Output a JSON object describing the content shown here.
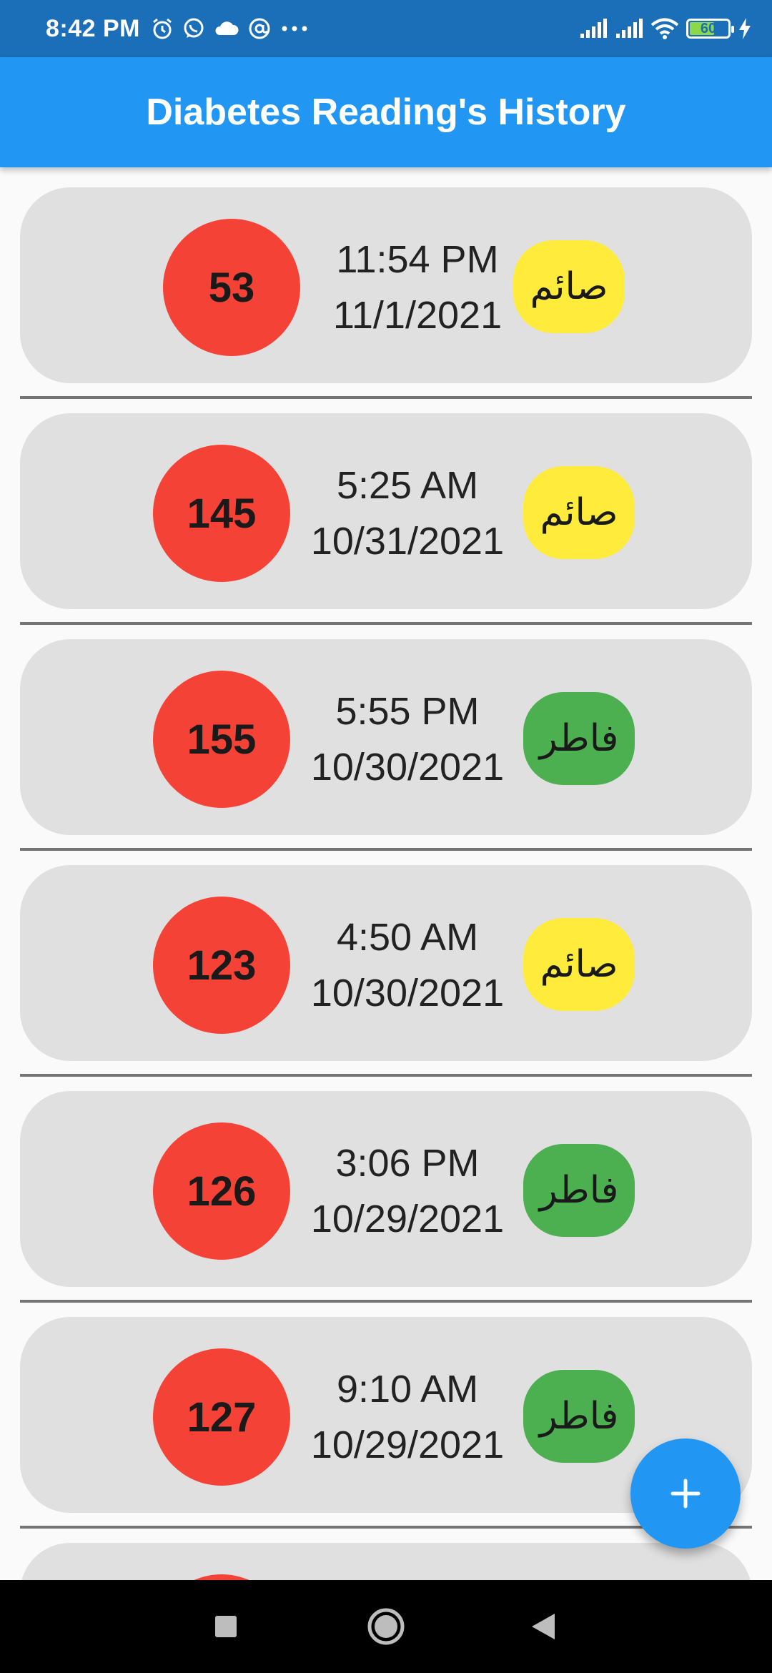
{
  "status_bar": {
    "time": "8:42 PM",
    "battery_level": "60",
    "colors": {
      "background": "#1a6fb8",
      "battery_fill": "#8bd84a"
    },
    "left_icons": [
      "alarm-icon",
      "whatsapp-icon",
      "cloud-icon",
      "at-sign-icon",
      "more-dots-icon"
    ],
    "right_icons": [
      "signal-icon",
      "signal-icon",
      "wifi-icon",
      "battery-icon",
      "charging-bolt-icon"
    ]
  },
  "app_bar": {
    "title": "Diabetes Reading's History",
    "color": "#2196f3"
  },
  "colors": {
    "card": "#e0e0e0",
    "reading_circle": "#f44336",
    "fasting_pill": "#ffeb3b",
    "non_fasting_pill": "#4caf50",
    "divider": "#757575",
    "fab": "#2196f3"
  },
  "readings": [
    {
      "value": "53",
      "time": "11:54 PM",
      "date": "11/1/2021",
      "status": "صائم",
      "status_type": "fasting"
    },
    {
      "value": "145",
      "time": "5:25 AM",
      "date": "10/31/2021",
      "status": "صائم",
      "status_type": "fasting"
    },
    {
      "value": "155",
      "time": "5:55 PM",
      "date": "10/30/2021",
      "status": "فاطر",
      "status_type": "non-fasting"
    },
    {
      "value": "123",
      "time": "4:50 AM",
      "date": "10/30/2021",
      "status": "صائم",
      "status_type": "fasting"
    },
    {
      "value": "126",
      "time": "3:06 PM",
      "date": "10/29/2021",
      "status": "فاطر",
      "status_type": "non-fasting"
    },
    {
      "value": "127",
      "time": "9:10 AM",
      "date": "10/29/2021",
      "status": "فاطر",
      "status_type": "non-fasting"
    }
  ],
  "fab": {
    "icon": "plus-icon",
    "label": "+"
  },
  "nav_bar": {
    "icons": [
      "recents-square-icon",
      "home-circle-icon",
      "back-triangle-icon"
    ]
  }
}
